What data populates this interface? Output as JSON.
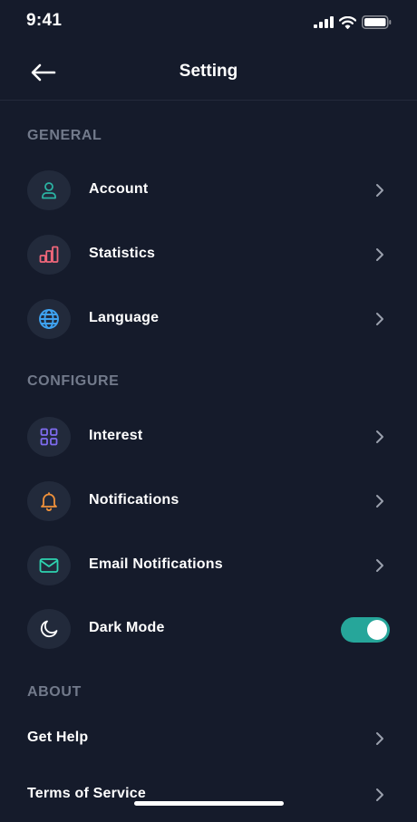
{
  "status": {
    "time": "9:41"
  },
  "header": {
    "title": "Setting"
  },
  "sections": {
    "general": "GENERAL",
    "configure": "CONFIGURE",
    "about": "ABOUT"
  },
  "items": {
    "account": "Account",
    "statistics": "Statistics",
    "language": "Language",
    "interest": "Interest",
    "notifications": "Notifications",
    "email_notifications": "Email Notifications",
    "dark_mode": "Dark Mode",
    "get_help": "Get Help",
    "terms": "Terms of Service"
  },
  "toggles": {
    "dark_mode": true
  },
  "icons": {
    "account": "user-icon",
    "statistics": "bar-chart-icon",
    "language": "globe-icon",
    "interest": "grid-icon",
    "notifications": "bell-icon",
    "email_notifications": "mail-icon",
    "dark_mode": "moon-icon"
  },
  "colors": {
    "background": "#151b2b",
    "icon_bg": "#222a3b",
    "account": "#2bb3a3",
    "statistics": "#f0677a",
    "language": "#3ea2f0",
    "interest": "#7f6cf0",
    "notifications": "#f0913a",
    "email": "#2ed3b0",
    "toggle_on": "#26a69a",
    "section_text": "#727a8b"
  }
}
